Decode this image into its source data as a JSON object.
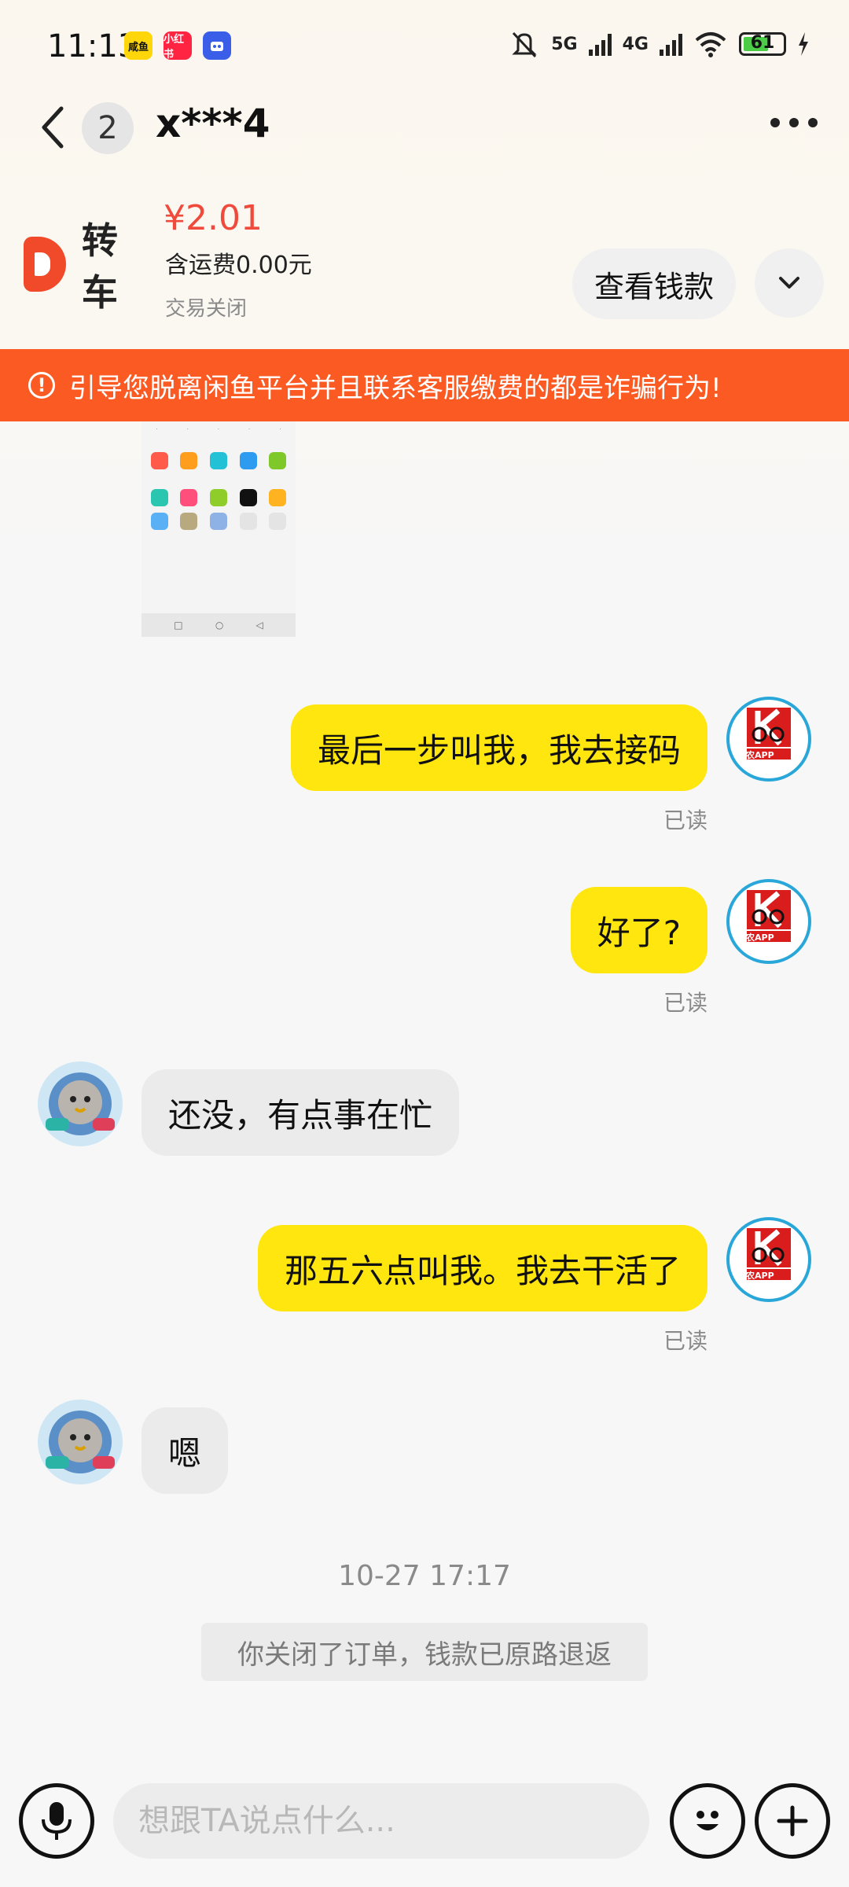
{
  "status_bar": {
    "time": "11:13",
    "app_icons": [
      {
        "name": "xianyu-icon",
        "label": "咸鱼",
        "color": "#ffd60a"
      },
      {
        "name": "xiaohongshu-icon",
        "label": "小红书",
        "color": "#ff2442"
      },
      {
        "name": "bot-app-icon",
        "label": "",
        "color": "#3a5ee8"
      }
    ],
    "net1": "5G",
    "net2": "4G",
    "battery": "61"
  },
  "header": {
    "unread_count": "2",
    "title": "x***4"
  },
  "order": {
    "thumb_text": "转车",
    "price": "¥2.01",
    "shipping": "含运费0.00元",
    "status": "交易关闭",
    "view_money_label": "查看钱款"
  },
  "warning": {
    "icon": "!",
    "text": "引导您脱离闲鱼平台并且联系客服缴费的都是诈骗行为!"
  },
  "messages": [
    {
      "from": "me",
      "text": "最后一步叫我，我去接码",
      "status": "已读"
    },
    {
      "from": "me",
      "text": "好了?",
      "status": "已读"
    },
    {
      "from": "other",
      "text": "还没，有点事在忙"
    },
    {
      "from": "me",
      "text": "那五六点叫我。我去干活了",
      "status": "已读"
    },
    {
      "from": "other",
      "text": "嗯"
    }
  ],
  "avatar_me_label": "卡农APP",
  "timestamp": "10-27 17:17",
  "system_note": "你关闭了订单，钱款已原路退返",
  "input": {
    "placeholder": "想跟TA说点什么..."
  }
}
